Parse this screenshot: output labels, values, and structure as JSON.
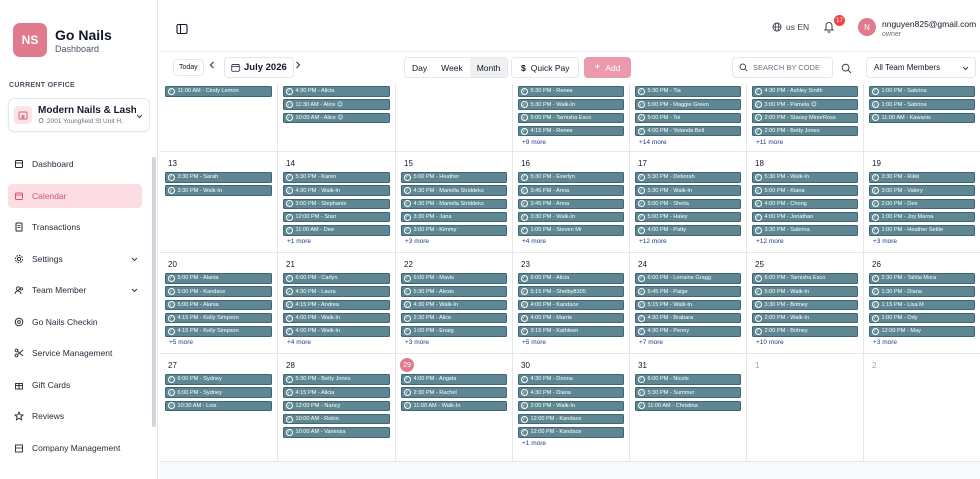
{
  "brand": {
    "initials": "NS",
    "name": "Go Nails",
    "subtitle": "Dashboard",
    "color": "#e07a8c"
  },
  "office": {
    "section_label": "CURRENT OFFICE",
    "name": "Modern Nails & Lash",
    "address": "2001 Youngfield St Unit H,"
  },
  "nav": [
    {
      "label": "Dashboard",
      "icon": "dashboard-icon",
      "active": false,
      "expandable": false
    },
    {
      "label": "Calendar",
      "icon": "calendar-icon",
      "active": true,
      "expandable": false
    },
    {
      "label": "Transactions",
      "icon": "transactions-icon",
      "active": false,
      "expandable": false
    },
    {
      "label": "Settings",
      "icon": "settings-icon",
      "active": false,
      "expandable": true
    },
    {
      "label": "Team Member",
      "icon": "team-icon",
      "active": false,
      "expandable": true
    },
    {
      "label": "Go Nails Checkin",
      "icon": "checkin-icon",
      "active": false,
      "expandable": false
    },
    {
      "label": "Service Management",
      "icon": "scissors-icon",
      "active": false,
      "expandable": false
    },
    {
      "label": "Gift Cards",
      "icon": "gift-icon",
      "active": false,
      "expandable": false
    },
    {
      "label": "Reviews",
      "icon": "star-icon",
      "active": false,
      "expandable": false
    },
    {
      "label": "Company Management",
      "icon": "company-icon",
      "active": false,
      "expandable": false
    }
  ],
  "header": {
    "language": "us EN",
    "notifications": "17",
    "user_initial": "N",
    "user_name": "nnguyen825@gmail.com",
    "user_role": "owner"
  },
  "toolbar": {
    "today_label": "Today",
    "month_label": "July 2026",
    "views": [
      {
        "label": "Day",
        "active": false
      },
      {
        "label": "Week",
        "active": false
      },
      {
        "label": "Month",
        "active": true
      }
    ],
    "quick_pay_label": "Quick Pay",
    "add_label": "Add",
    "search_placeholder": "SEARCH BY CODE",
    "member_filter": "All Team Members"
  },
  "colors": {
    "event": "#5f8793",
    "accent": "#e07a8c",
    "add_button": "#ec9aab",
    "more_link": "#1e3a8a"
  },
  "calendar": {
    "weeks": [
      {
        "days": [
          {
            "day": "",
            "events": [
              "11:00 AM - Cindy Lemon"
            ],
            "more": ""
          },
          {
            "day": "",
            "events": [
              "4:30 PM - Alicia",
              "11:30 AM - Alice 😊",
              "10:00 AM - Alice 😊"
            ],
            "more": ""
          },
          {
            "day": "",
            "events": [],
            "more": ""
          },
          {
            "day": "",
            "events": [
              "5:30 PM - Renee",
              "5:30 PM - Walk-In",
              "5:00 PM - Tarnisha Esco",
              "4:15 PM - Renee"
            ],
            "more": "+9 more"
          },
          {
            "day": "",
            "events": [
              "5:30 PM - Tia",
              "5:00 PM - Maggie Green",
              "5:00 PM - Toi",
              "4:00 PM - Yolanda Bell"
            ],
            "more": "+14 more"
          },
          {
            "day": "",
            "events": [
              "4:30 PM - Ashley Smith",
              "3:00 PM - Pamela 😊",
              "2:00 PM - Stacey MinorRoss",
              "2:00 PM - Betty Jones"
            ],
            "more": "+11 more"
          },
          {
            "day": "",
            "events": [
              "1:00 PM - Sabrina",
              "1:00 PM - Sabrina",
              "11:00 AM - Kawanis"
            ],
            "more": ""
          }
        ]
      },
      {
        "days": [
          {
            "day": "13",
            "events": [
              "3:30 PM - Sarah",
              "3:30 PM - Walk-In"
            ],
            "more": ""
          },
          {
            "day": "14",
            "events": [
              "5:30 PM - Karen",
              "4:30 PM - Walk-In",
              "3:00 PM - Stephanie",
              "12:00 PM - Starr",
              "11:00 AM - Dee"
            ],
            "more": "+1 more"
          },
          {
            "day": "15",
            "events": [
              "5:00 PM - Heather",
              "4:30 PM - Mariella Striddeks",
              "4:30 PM - Mariella Striddeks",
              "3:30 PM - Jana",
              "3:00 PM - Kimmy"
            ],
            "more": "+3 more"
          },
          {
            "day": "16",
            "events": [
              "5:30 PM - Everlyn",
              "3:45 PM - Anna",
              "3:45 PM - Anna",
              "3:30 PM - Walk-In",
              "1:00 PM - Steven Mr"
            ],
            "more": "+4 more"
          },
          {
            "day": "17",
            "events": [
              "5:30 PM - Deborah",
              "5:30 PM - Walk-In",
              "5:00 PM - Sheila",
              "5:00 PM - Haley",
              "4:00 PM - Patty"
            ],
            "more": "+12 more"
          },
          {
            "day": "18",
            "events": [
              "5:30 PM - Walk-In",
              "5:00 PM - Kiana",
              "4:00 PM - Chong",
              "4:00 PM - Jonathan",
              "3:30 PM - Sabrina"
            ],
            "more": "+12 more"
          },
          {
            "day": "19",
            "events": [
              "3:30 PM - Rikki",
              "3:00 PM - Valery",
              "2:00 PM - Dee",
              "1:00 PM - Joy Marna",
              "1:00 PM - Heather Settle"
            ],
            "more": "+3 more"
          }
        ]
      },
      {
        "days": [
          {
            "day": "20",
            "events": [
              "5:00 PM - Alania",
              "5:00 PM - Kandace",
              "5:00 PM - Alania",
              "4:15 PM - Kelly Simpson",
              "4:15 PM - Kelly Simpson"
            ],
            "more": "+5 more"
          },
          {
            "day": "21",
            "events": [
              "6:00 PM - Carlyn",
              "4:30 PM - Laura",
              "4:15 PM - Andrea",
              "4:00 PM - Walk-In",
              "4:00 PM - Walk-In"
            ],
            "more": "+4 more"
          },
          {
            "day": "22",
            "events": [
              "6:00 PM - Mavis",
              "5:30 PM - Alexis",
              "4:30 PM - Walk-In",
              "2:30 PM - Alice",
              "1:00 PM - Enaig"
            ],
            "more": "+3 more"
          },
          {
            "day": "23",
            "events": [
              "6:00 PM - Alicia",
              "5:15 PM - Shelby8305",
              "4:00 PM - Kandace",
              "4:00 PM - Marrie",
              "3:15 PM - Kathleen"
            ],
            "more": "+5 more"
          },
          {
            "day": "24",
            "events": [
              "6:00 PM - Lorraine Gragg",
              "5:45 PM - Paige",
              "5:15 PM - Walk-In",
              "4:30 PM - Brabara",
              "4:30 PM - Penny"
            ],
            "more": "+7 more"
          },
          {
            "day": "25",
            "events": [
              "6:00 PM - Tarnisha Esco",
              "5:00 PM - Walk-In",
              "3:30 PM - Britney",
              "2:00 PM - Walk-In",
              "2:00 PM - Britney"
            ],
            "more": "+10 more"
          },
          {
            "day": "26",
            "events": [
              "2:30 PM - Tahlia Mora",
              "1:30 PM - Diana",
              "1:15 PM - Lisa M",
              "1:00 PM - Ody",
              "12:00 PM - May"
            ],
            "more": "+3 more"
          }
        ]
      },
      {
        "days": [
          {
            "day": "27",
            "events": [
              "6:00 PM - Sydney",
              "6:00 PM - Sydney",
              "10:30 AM - Lois"
            ],
            "more": ""
          },
          {
            "day": "28",
            "events": [
              "5:30 PM - Betty Jones",
              "4:15 PM - Alicia",
              "12:00 PM - Nancy",
              "10:00 AM - Robin",
              "10:00 AM - Vanessa"
            ],
            "more": ""
          },
          {
            "day": "29",
            "events": [
              "4:00 PM - Angela",
              "2:30 PM - Rachel",
              "11:00 AM - Walk-In"
            ],
            "more": "",
            "today": true
          },
          {
            "day": "30",
            "events": [
              "4:30 PM - Donna",
              "4:30 PM - Diana",
              "2:00 PM - Walk-In",
              "12:00 PM - Kandace",
              "12:00 PM - Kandace"
            ],
            "more": "+1 more"
          },
          {
            "day": "31",
            "events": [
              "6:00 PM - Nicole",
              "5:30 PM - Summer",
              "11:00 AM - Christina"
            ],
            "more": ""
          },
          {
            "day": "1",
            "events": [],
            "more": "",
            "muted": true
          },
          {
            "day": "2",
            "events": [],
            "more": "",
            "muted": true
          }
        ]
      }
    ]
  }
}
